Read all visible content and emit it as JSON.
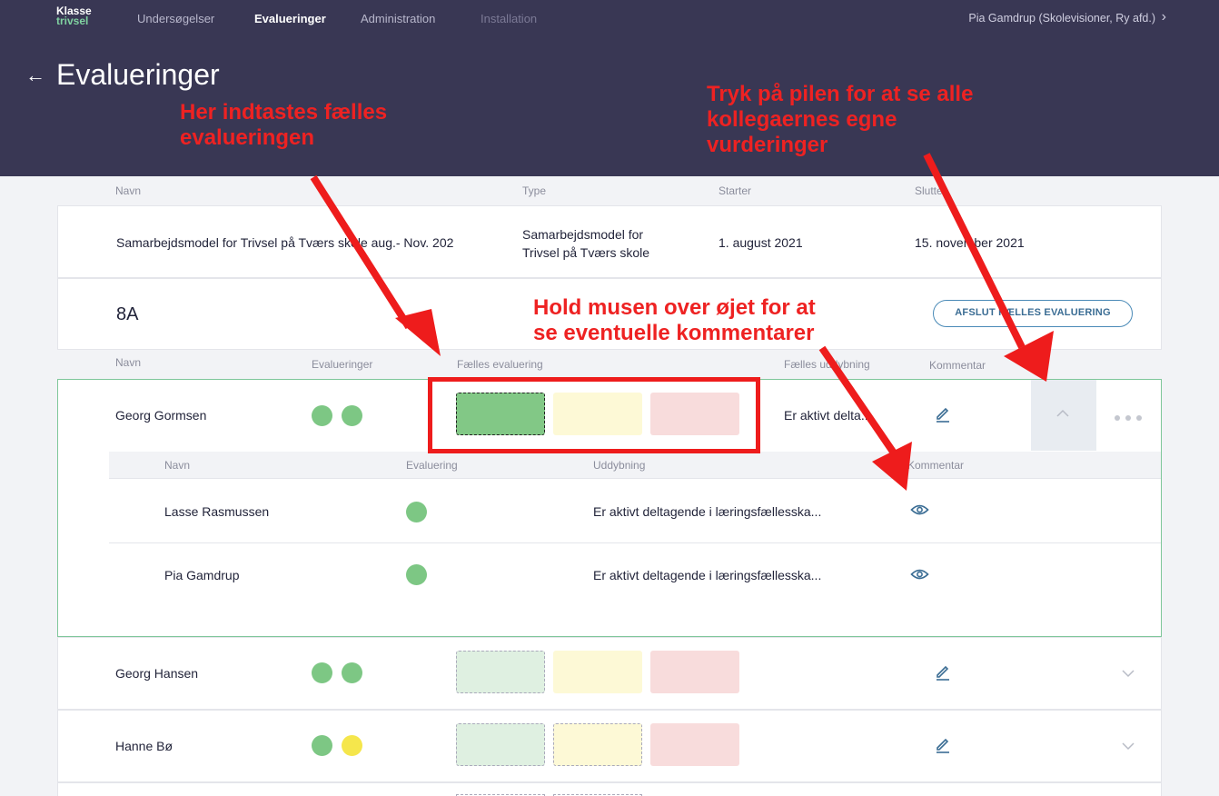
{
  "header": {
    "logo_line1": "Klasse",
    "logo_line2": "trivsel",
    "nav": [
      "Undersøgelser",
      "Evalueringer",
      "Administration",
      "Installation"
    ],
    "user": "Pia Gamdrup (Skolevisioner, Ry afd.)",
    "page_title": "Evalueringer"
  },
  "annotations": {
    "a1": "Her indtastes fælles\nevalueringen",
    "a2": "Tryk på pilen for at se alle\nkollegaernes egne\nvurderinger",
    "a3": "Hold musen over øjet for at\nse eventuelle kommentarer"
  },
  "evaluation_table": {
    "headers": [
      "Navn",
      "Type",
      "Starter",
      "Slutter"
    ],
    "row": {
      "name": "Samarbejdsmodel for Trivsel på Tværs skole aug.- Nov. 202",
      "type_line1": "Samarbejdsmodel for",
      "type_line2": "Trivsel på Tværs skole",
      "start": "1. august 2021",
      "end": "15. november 2021"
    }
  },
  "class_section": {
    "class_name": "8A",
    "finish_button": "AFSLUT FÆLLES EVALUERING",
    "headers": [
      "Navn",
      "Evalueringer",
      "Fælles evaluering",
      "Fælles uddybning",
      "Kommentar"
    ],
    "sub_headers": [
      "Navn",
      "Evaluering",
      "Uddybning",
      "Kommentar"
    ],
    "students": [
      {
        "name": "Georg Gormsen",
        "dots": [
          "#7dc784",
          "#7dc784"
        ],
        "selected": "green",
        "uddybning": "Er aktivt delta...",
        "expanded": true,
        "colleagues": [
          {
            "name": "Lasse Rasmussen",
            "dot": "#7dc784",
            "uddybning": "Er aktivt deltagende i læringsfællesska..."
          },
          {
            "name": "Pia Gamdrup",
            "dot": "#7dc784",
            "uddybning": "Er aktivt deltagende i læringsfællesska..."
          }
        ]
      },
      {
        "name": "Georg Hansen",
        "dots": [
          "#7dc784",
          "#7dc784"
        ],
        "selected": "none",
        "expanded": false
      },
      {
        "name": "Hanne Bø",
        "dots": [
          "#7dc784",
          "#f5e64c"
        ],
        "selected": "none",
        "expanded": false
      }
    ]
  },
  "colors": {
    "header_bg": "#393754",
    "green_selected": "#82c886",
    "green_light": "#dff0e1",
    "yellow_light": "#fdf9d6",
    "red_light": "#f8dcdc",
    "annotation_red": "#ee2222",
    "accent_blue": "#3b6d94"
  }
}
